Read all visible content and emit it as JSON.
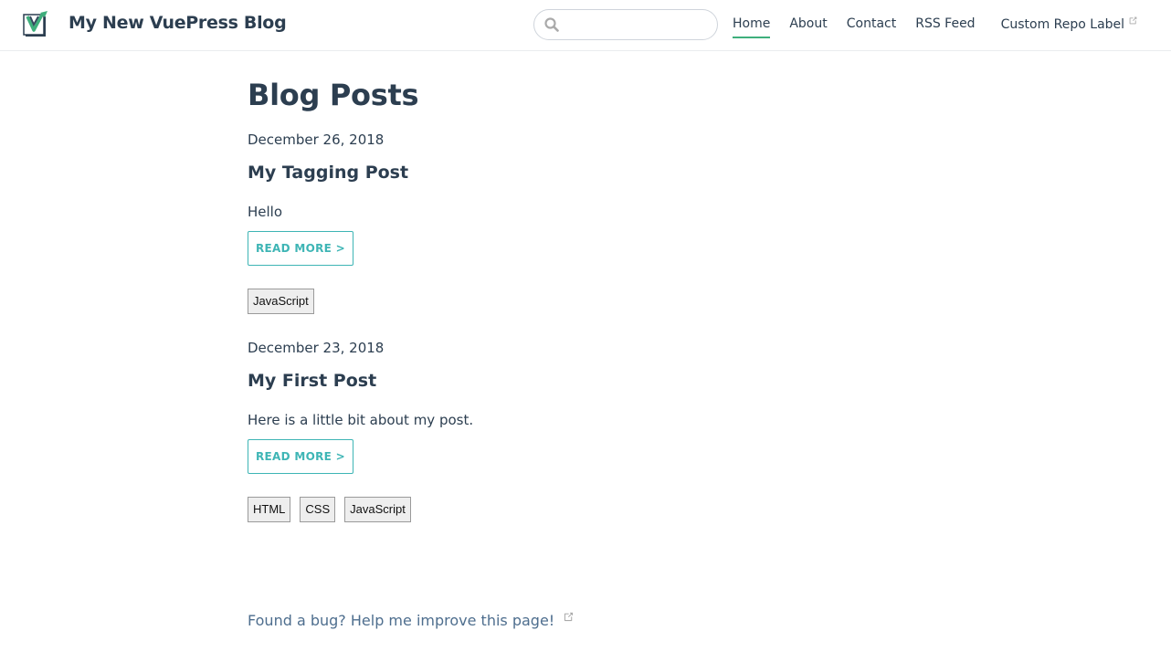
{
  "navbar": {
    "site_name": "My New VuePress Blog",
    "search": {
      "placeholder": "",
      "value": ""
    },
    "links": [
      {
        "label": "Home",
        "active": true
      },
      {
        "label": "About",
        "active": false
      },
      {
        "label": "Contact",
        "active": false
      },
      {
        "label": "RSS Feed",
        "active": false
      },
      {
        "label": "Custom Repo Label",
        "active": false,
        "external": true
      }
    ]
  },
  "main": {
    "title": "Blog Posts",
    "posts": [
      {
        "date": "December 26, 2018",
        "title": "My Tagging Post",
        "summary": "Hello",
        "read_more": "READ MORE >",
        "tags": [
          "JavaScript"
        ]
      },
      {
        "date": "December 23, 2018",
        "title": "My First Post",
        "summary": "Here is a little bit about my post.",
        "read_more": "READ MORE >",
        "tags": [
          "HTML",
          "CSS",
          "JavaScript"
        ]
      }
    ]
  },
  "footer": {
    "edit_link": "Found a bug? Help me improve this page!"
  },
  "colors": {
    "accent": "#3eaf7c",
    "read_more": "#3eb5b5",
    "text": "#2c3e50",
    "link": "#4e6e8e"
  },
  "icons": {
    "logo": "vuepress-logo-icon",
    "search": "search-icon",
    "external": "external-link-icon"
  }
}
